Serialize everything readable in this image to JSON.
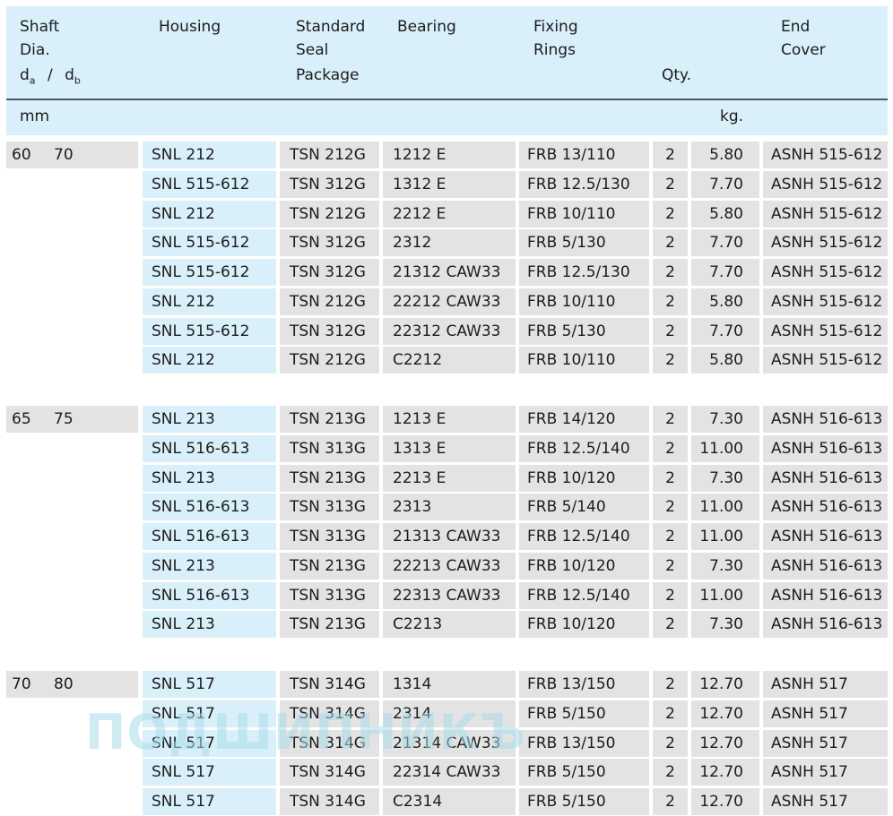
{
  "header": {
    "shaft": [
      "Shaft",
      "Dia."
    ],
    "shaft_sym": {
      "da": "d",
      "a": "a",
      "sep": "/",
      "db": "d",
      "b": "b"
    },
    "housing": "Housing",
    "seal": [
      "Standard",
      "Seal",
      "Package"
    ],
    "bearing": "Bearing",
    "fixing": [
      "Fixing",
      "Rings"
    ],
    "qty": "Qty.",
    "endcover": [
      "End",
      "Cover"
    ],
    "unit_mm": "mm",
    "unit_kg": "kg."
  },
  "groups": [
    {
      "da": "60",
      "db": "70",
      "rows": [
        [
          "SNL 212",
          "TSN 212G",
          "1212 E",
          "FRB 13/110",
          "2",
          "5.80",
          "ASNH 515-612"
        ],
        [
          "SNL 515-612",
          "TSN 312G",
          "1312 E",
          "FRB 12.5/130",
          "2",
          "7.70",
          "ASNH 515-612"
        ],
        [
          "SNL 212",
          "TSN 212G",
          "2212 E",
          "FRB 10/110",
          "2",
          "5.80",
          "ASNH 515-612"
        ],
        [
          "SNL 515-612",
          "TSN 312G",
          "2312",
          "FRB 5/130",
          "2",
          "7.70",
          "ASNH 515-612"
        ],
        [
          "SNL 515-612",
          "TSN 312G",
          "21312 CAW33",
          "FRB 12.5/130",
          "2",
          "7.70",
          "ASNH 515-612"
        ],
        [
          "SNL 212",
          "TSN 212G",
          "22212 CAW33",
          "FRB 10/110",
          "2",
          "5.80",
          "ASNH 515-612"
        ],
        [
          "SNL 515-612",
          "TSN 312G",
          "22312 CAW33",
          "FRB 5/130",
          "2",
          "7.70",
          "ASNH 515-612"
        ],
        [
          "SNL 212",
          "TSN 212G",
          "C2212",
          "FRB 10/110",
          "2",
          "5.80",
          "ASNH 515-612"
        ]
      ]
    },
    {
      "da": "65",
      "db": "75",
      "rows": [
        [
          "SNL 213",
          "TSN 213G",
          "1213 E",
          "FRB 14/120",
          "2",
          "7.30",
          "ASNH 516-613"
        ],
        [
          "SNL 516-613",
          "TSN 313G",
          "1313 E",
          "FRB 12.5/140",
          "2",
          "11.00",
          "ASNH 516-613"
        ],
        [
          "SNL 213",
          "TSN 213G",
          "2213 E",
          "FRB 10/120",
          "2",
          "7.30",
          "ASNH 516-613"
        ],
        [
          "SNL 516-613",
          "TSN 313G",
          "2313",
          "FRB 5/140",
          "2",
          "11.00",
          "ASNH 516-613"
        ],
        [
          "SNL 516-613",
          "TSN 313G",
          "21313 CAW33",
          "FRB 12.5/140",
          "2",
          "11.00",
          "ASNH 516-613"
        ],
        [
          "SNL 213",
          "TSN 213G",
          "22213 CAW33",
          "FRB 10/120",
          "2",
          "7.30",
          "ASNH 516-613"
        ],
        [
          "SNL 516-613",
          "TSN 313G",
          "22313  CAW33",
          "FRB 12.5/140",
          "2",
          "11.00",
          "ASNH 516-613"
        ],
        [
          "SNL 213",
          "TSN 213G",
          "C2213",
          "FRB 10/120",
          "2",
          "7.30",
          "ASNH 516-613"
        ]
      ]
    },
    {
      "da": "70",
      "db": "80",
      "rows": [
        [
          "SNL 517",
          "TSN 314G",
          "1314",
          "FRB 13/150",
          "2",
          "12.70",
          "ASNH 517"
        ],
        [
          "SNL 517",
          "TSN 314G",
          "2314",
          "FRB 5/150",
          "2",
          "12.70",
          "ASNH 517"
        ],
        [
          "SNL 517",
          "TSN 314G",
          "21314 CAW33",
          "FRB 13/150",
          "2",
          "12.70",
          "ASNH 517"
        ],
        [
          "SNL 517",
          "TSN 314G",
          "22314 CAW33",
          "FRB 5/150",
          "2",
          "12.70",
          "ASNH 517"
        ],
        [
          "SNL 517",
          "TSN 314G",
          "C2314",
          "FRB 5/150",
          "2",
          "12.70",
          "ASNH 517"
        ]
      ]
    }
  ],
  "watermark": "ПОДШИПНИКЪ",
  "colors": {
    "header_bg": "#d9effa",
    "housing_col_bg": "#d9effa",
    "cell_bg": "#e3e3e3",
    "rule": "#4c5a66"
  }
}
